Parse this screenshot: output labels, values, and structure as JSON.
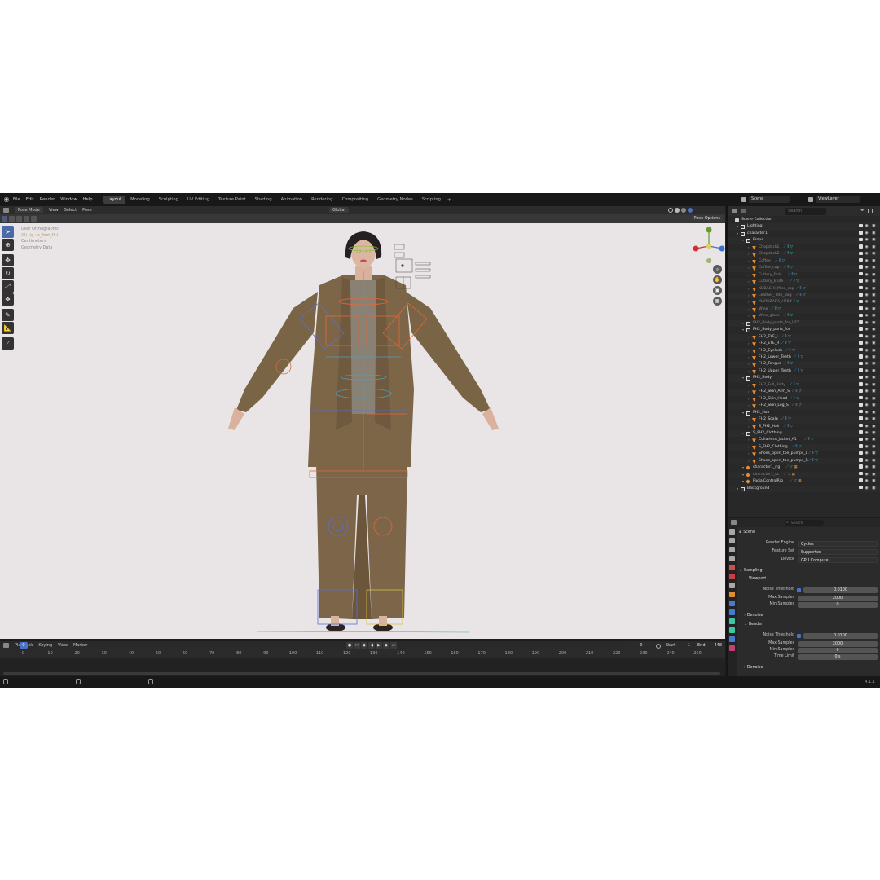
{
  "topbar": {
    "menus": [
      "File",
      "Edit",
      "Render",
      "Window",
      "Help"
    ],
    "tabs": [
      "Layout",
      "Modeling",
      "Sculpting",
      "UV Editing",
      "Texture Paint",
      "Shading",
      "Animation",
      "Rendering",
      "Compositing",
      "Geometry Nodes",
      "Scripting"
    ],
    "active_tab": "Layout",
    "scene": "Scene",
    "view_layer": "ViewLayer"
  },
  "viewport": {
    "mode": "Pose Mode",
    "menus": [
      "View",
      "Select",
      "Pose"
    ],
    "transform_orientation": "Global",
    "pose_options": "Pose Options",
    "info": [
      "User Orthographic",
      "(0) rig : c_foot_fk.l",
      "Centimeters",
      "Geometry Data"
    ]
  },
  "timeline": {
    "menus": [
      "Playback",
      "Keying",
      "View",
      "Marker"
    ],
    "current_frame": "0",
    "start_label": "Start",
    "start": "1",
    "end_label": "End",
    "end": "448",
    "ticks": [
      "0",
      "10",
      "20",
      "30",
      "40",
      "50",
      "60",
      "70",
      "80",
      "90",
      "100",
      "110",
      "120",
      "130",
      "140",
      "150",
      "160",
      "170",
      "180",
      "190",
      "200",
      "210",
      "220",
      "230",
      "240",
      "250"
    ]
  },
  "outliner": {
    "search_placeholder": "Search",
    "rows": [
      {
        "label": "Scene Collection",
        "depth": 0,
        "type": "scene"
      },
      {
        "label": "Lighting",
        "depth": 1,
        "type": "coll"
      },
      {
        "label": "character1",
        "depth": 1,
        "type": "coll"
      },
      {
        "label": "Props",
        "depth": 2,
        "type": "coll"
      },
      {
        "label": "Chopstick1",
        "depth": 3,
        "type": "obj",
        "dim": true
      },
      {
        "label": "Chopstick2",
        "depth": 3,
        "type": "obj",
        "dim": true
      },
      {
        "label": "Coffee",
        "depth": 3,
        "type": "obj",
        "dim": true
      },
      {
        "label": "Coffee_cup",
        "depth": 3,
        "type": "obj",
        "dim": true
      },
      {
        "label": "Cutlery_fork",
        "depth": 3,
        "type": "obj",
        "dim": true
      },
      {
        "label": "Cutlery_knife",
        "depth": 3,
        "type": "obj",
        "dim": true
      },
      {
        "label": "KOBACHI_Miso_sop",
        "depth": 3,
        "type": "obj",
        "dim": true
      },
      {
        "label": "Leather_Tote_Bag",
        "depth": 3,
        "type": "obj",
        "dim": true
      },
      {
        "label": "MARUZARA_HT00",
        "depth": 3,
        "type": "obj",
        "dim": true
      },
      {
        "label": "Wine",
        "depth": 3,
        "type": "obj",
        "dim": true
      },
      {
        "label": "Wine_glass",
        "depth": 3,
        "type": "obj",
        "dim": true
      },
      {
        "label": "FH2_Body_parts_for_UE5",
        "depth": 2,
        "type": "coll",
        "dim": true
      },
      {
        "label": "FH2_Body_parts_for",
        "depth": 2,
        "type": "coll"
      },
      {
        "label": "FH2_EYE_L",
        "depth": 3,
        "type": "obj"
      },
      {
        "label": "FH2_EYE_R",
        "depth": 3,
        "type": "obj"
      },
      {
        "label": "FH2_Eyelash",
        "depth": 3,
        "type": "obj"
      },
      {
        "label": "FH2_Lower_Teeth",
        "depth": 3,
        "type": "obj"
      },
      {
        "label": "FH2_Tongue",
        "depth": 3,
        "type": "obj"
      },
      {
        "label": "FH2_Upper_Teeth",
        "depth": 3,
        "type": "obj"
      },
      {
        "label": "FH2_Body",
        "depth": 2,
        "type": "coll"
      },
      {
        "label": "FH2_Full_Body",
        "depth": 3,
        "type": "obj",
        "dim": true
      },
      {
        "label": "FH2_Skin_Arm_S",
        "depth": 3,
        "type": "obj"
      },
      {
        "label": "FH2_Skin_Head",
        "depth": 3,
        "type": "obj"
      },
      {
        "label": "FH2_Skin_Leg_S",
        "depth": 3,
        "type": "obj"
      },
      {
        "label": "FH2_Hair",
        "depth": 2,
        "type": "coll"
      },
      {
        "label": "FH2_Scalp",
        "depth": 3,
        "type": "obj"
      },
      {
        "label": "S_FH2_Hair",
        "depth": 3,
        "type": "obj"
      },
      {
        "label": "S_FH2_Clothing",
        "depth": 2,
        "type": "coll"
      },
      {
        "label": "Collarless_Jacket_A1",
        "depth": 3,
        "type": "obj"
      },
      {
        "label": "S_FH2_Clothing",
        "depth": 3,
        "type": "obj"
      },
      {
        "label": "Shoes_open_toe_pumps_L",
        "depth": 3,
        "type": "obj"
      },
      {
        "label": "Shoes_open_toe_pumps_R",
        "depth": 3,
        "type": "obj"
      },
      {
        "label": "character1_rig",
        "depth": 2,
        "type": "arm"
      },
      {
        "label": "character1_cc",
        "depth": 2,
        "type": "arm",
        "dim": true
      },
      {
        "label": "FacialControlRig",
        "depth": 2,
        "type": "arm"
      },
      {
        "label": "Background",
        "depth": 1,
        "type": "coll"
      }
    ]
  },
  "properties": {
    "search_placeholder": "Search",
    "context": "Scene",
    "render_engine_label": "Render Engine",
    "render_engine": "Cycles",
    "feature_set_label": "Feature Set",
    "feature_set": "Supported",
    "device_label": "Device",
    "device": "GPU Compute",
    "sampling": "Sampling",
    "viewport_section": "Viewport",
    "render_section": "Render",
    "denoise": "Denoise",
    "noise_threshold_label": "Noise Threshold",
    "max_samples_label": "Max Samples",
    "min_samples_label": "Min Samples",
    "time_limit_label": "Time Limit",
    "viewport_noise_threshold": "0.0100",
    "viewport_max_samples": "2000",
    "viewport_min_samples": "0",
    "render_noise_threshold": "0.0100",
    "render_max_samples": "2000",
    "render_min_samples": "0",
    "render_time_limit": "0 s"
  },
  "statusbar": {
    "version": "4.1.1"
  },
  "colors": {
    "accent": "#4b72c8",
    "viewport_bg": "#e9e5e6",
    "jacket": "#7a6446",
    "bone_orange": "#e2673a",
    "bone_blue": "#5a6fd0"
  }
}
